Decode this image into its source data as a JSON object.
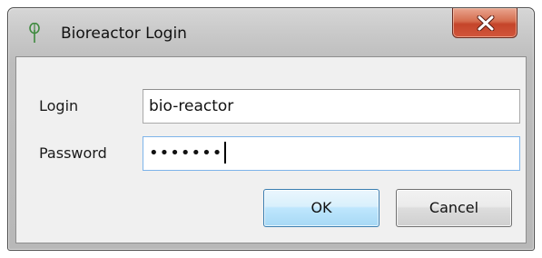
{
  "window": {
    "title": "Bioreactor Login",
    "app_icon": "bioreactor-app-icon",
    "close_icon": "close-x-icon"
  },
  "form": {
    "login_label": "Login",
    "login_value": "bio-reactor",
    "password_label": "Password",
    "password_masked": "•••••••"
  },
  "buttons": {
    "ok_label": "OK",
    "cancel_label": "Cancel"
  },
  "colors": {
    "close_button": "#c4452a",
    "ok_button_border": "#3c7fb1",
    "focus_border": "#7eb4ea"
  }
}
